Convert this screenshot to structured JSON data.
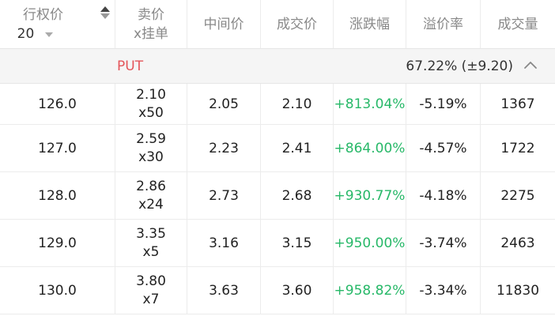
{
  "header": {
    "strike_label": "行权价",
    "strike_count": "20",
    "ask_label_line1": "卖价",
    "ask_label_line2": "x挂单",
    "mid_label": "中间价",
    "last_label": "成交价",
    "change_label": "涨跌幅",
    "premium_label": "溢价率",
    "volume_label": "成交量"
  },
  "section": {
    "label": "PUT",
    "iv": "67.22% (±9.20)"
  },
  "rows": [
    {
      "strike": "126.0",
      "ask_price": "2.10",
      "ask_size": "x50",
      "mid": "2.05",
      "last": "2.10",
      "change": "+813.04%",
      "premium": "-5.19%",
      "volume": "1367"
    },
    {
      "strike": "127.0",
      "ask_price": "2.59",
      "ask_size": "x30",
      "mid": "2.23",
      "last": "2.41",
      "change": "+864.00%",
      "premium": "-4.57%",
      "volume": "1722"
    },
    {
      "strike": "128.0",
      "ask_price": "2.86",
      "ask_size": "x24",
      "mid": "2.73",
      "last": "2.68",
      "change": "+930.77%",
      "premium": "-4.18%",
      "volume": "2275"
    },
    {
      "strike": "129.0",
      "ask_price": "3.35",
      "ask_size": "x5",
      "mid": "3.16",
      "last": "3.15",
      "change": "+950.00%",
      "premium": "-3.74%",
      "volume": "2463"
    },
    {
      "strike": "130.0",
      "ask_price": "3.80",
      "ask_size": "x7",
      "mid": "3.63",
      "last": "3.60",
      "change": "+958.82%",
      "premium": "-3.34%",
      "volume": "11830"
    }
  ],
  "colors": {
    "put": "#e4555a",
    "positive": "#27b868",
    "section_bg": "#f5f5f5"
  },
  "icons": {
    "sort": "sort-updown-icon",
    "dropdown": "caret-down-icon",
    "collapse": "chevron-up-icon"
  }
}
